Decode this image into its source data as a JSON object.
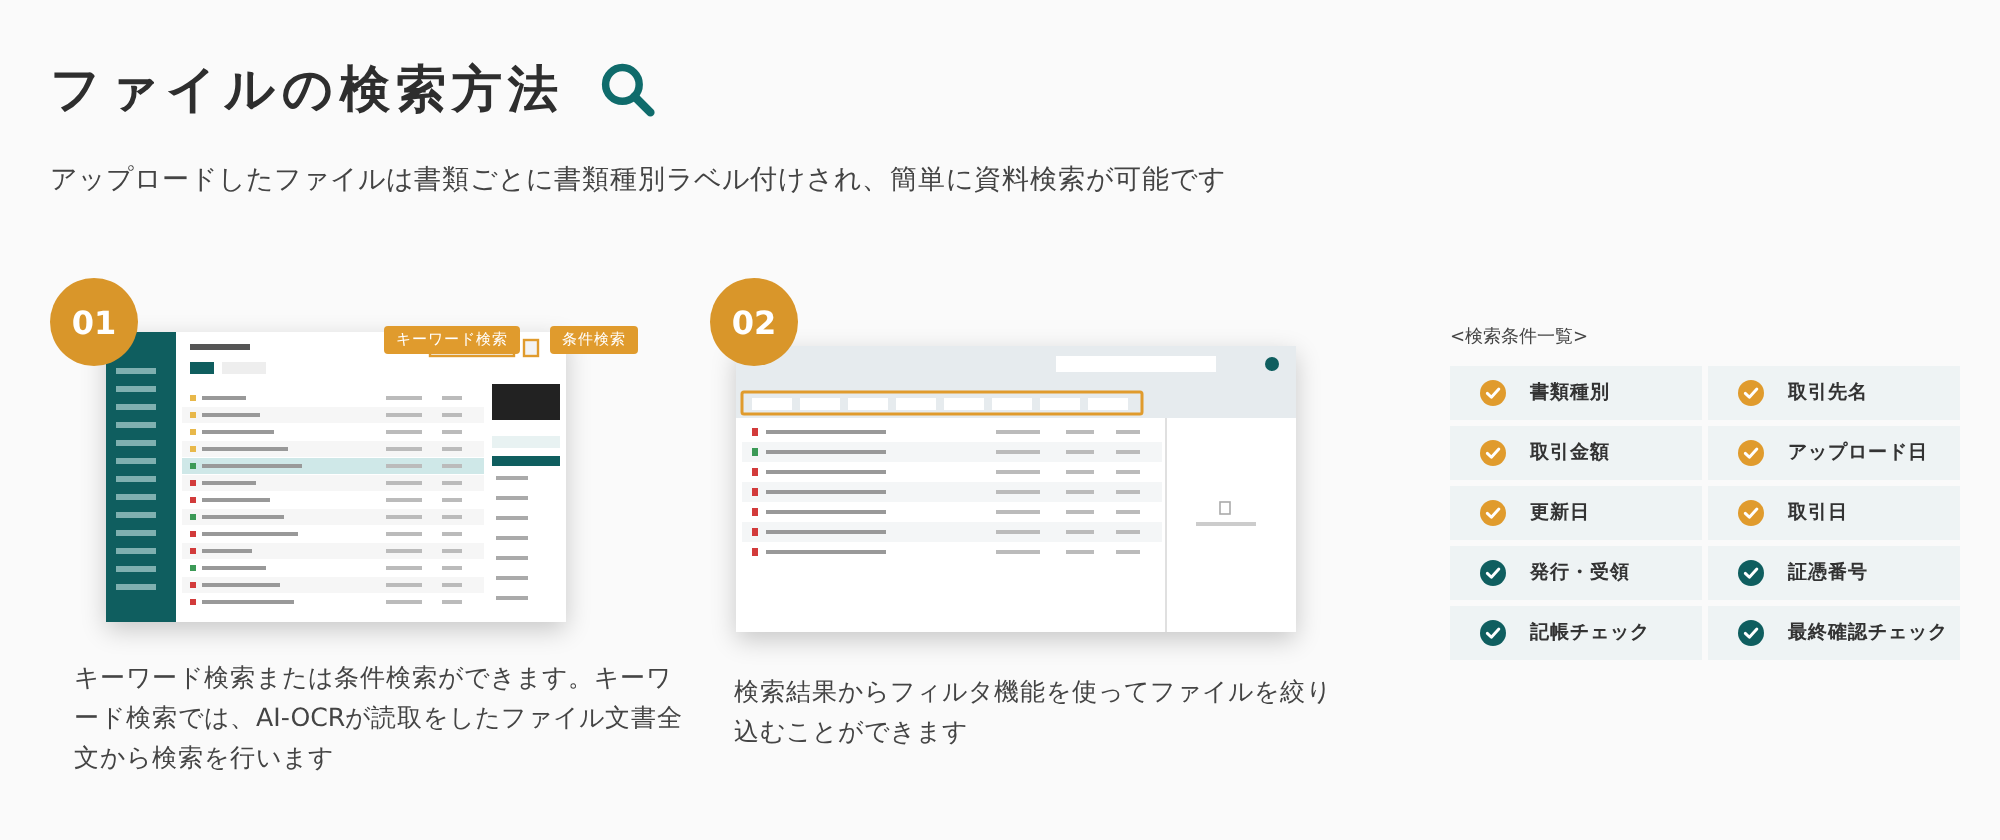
{
  "title": "ファイルの検索方法",
  "subtitle": "アップロードしたファイルは書類ごとに書類種別ラベル付けされ、簡単に資料検索が可能です",
  "steps": [
    {
      "number": "01",
      "callouts": [
        "キーワード検索",
        "条件検索"
      ],
      "caption": "キーワード検索または条件検索ができます。キーワード検索では、AI-OCRが読取をしたファイル文書全文から検索を行います"
    },
    {
      "number": "02",
      "caption": "検索結果からフィルタ機能を使ってファイルを絞り込むことができます"
    }
  ],
  "conditions": {
    "heading": "<検索条件一覧>",
    "items": [
      {
        "label": "書類種別",
        "color": "#e09b2d"
      },
      {
        "label": "取引先名",
        "color": "#e09b2d"
      },
      {
        "label": "取引金額",
        "color": "#e09b2d"
      },
      {
        "label": "アップロード日",
        "color": "#e09b2d"
      },
      {
        "label": "更新日",
        "color": "#e09b2d"
      },
      {
        "label": "取引日",
        "color": "#e09b2d"
      },
      {
        "label": "発行・受領",
        "color": "#0f5e5f"
      },
      {
        "label": "証憑番号",
        "color": "#0f5e5f"
      },
      {
        "label": "記帳チェック",
        "color": "#0f5e5f"
      },
      {
        "label": "最終確認チェック",
        "color": "#0f5e5f"
      }
    ]
  }
}
